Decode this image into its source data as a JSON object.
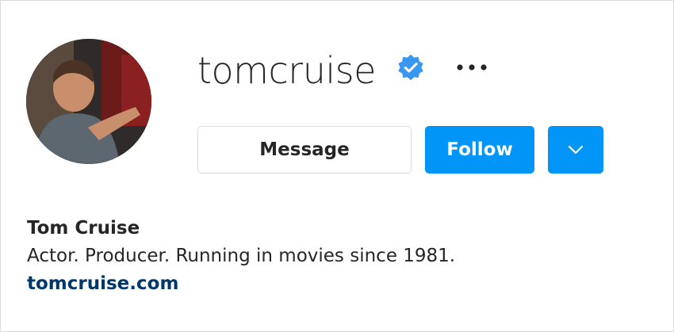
{
  "profile": {
    "username": "tomcruise",
    "full_name": "Tom Cruise",
    "bio": "Actor. Producer. Running in movies since 1981.",
    "website": "tomcruise.com",
    "verified": true
  },
  "actions": {
    "message_label": "Message",
    "follow_label": "Follow"
  },
  "icons": {
    "verified": "verified-badge-icon",
    "more": "more-options-icon",
    "dropdown": "chevron-down-icon"
  },
  "colors": {
    "accent": "#0095f6",
    "link": "#00376b",
    "text": "#262626",
    "border": "#dbdbdb"
  }
}
